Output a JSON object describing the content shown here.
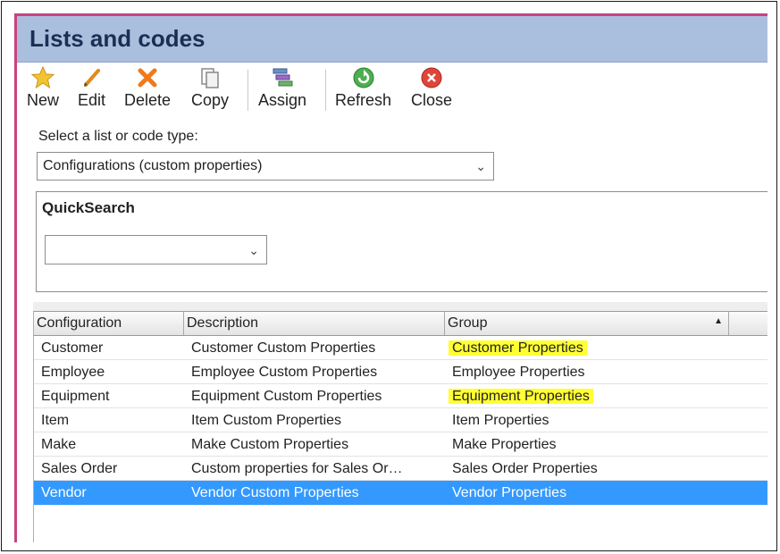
{
  "window": {
    "title": "Lists and codes"
  },
  "toolbar": {
    "new": "New",
    "edit": "Edit",
    "delete": "Delete",
    "copy": "Copy",
    "assign": "Assign",
    "refresh": "Refresh",
    "close": "Close"
  },
  "list_type": {
    "label": "Select a list or code type:",
    "value": "Configurations (custom properties)"
  },
  "quicksearch": {
    "title": "QuickSearch",
    "value": ""
  },
  "grid": {
    "columns": [
      "Configuration",
      "Description",
      "Group"
    ],
    "sort_column": "Group",
    "sort_direction": "ascending",
    "rows": [
      {
        "configuration": "Customer",
        "description": "Customer Custom Properties",
        "group": "Customer Properties",
        "highlight": true,
        "selected": false
      },
      {
        "configuration": "Employee",
        "description": "Employee Custom Properties",
        "group": "Employee Properties",
        "highlight": false,
        "selected": false
      },
      {
        "configuration": "Equipment",
        "description": "Equipment Custom Properties",
        "group": "Equipment Properties",
        "highlight": true,
        "selected": false
      },
      {
        "configuration": "Item",
        "description": "Item Custom Properties",
        "group": "Item Properties",
        "highlight": false,
        "selected": false
      },
      {
        "configuration": "Make",
        "description": "Make Custom Properties",
        "group": "Make Properties",
        "highlight": false,
        "selected": false
      },
      {
        "configuration": "Sales Order",
        "description": "Custom properties for Sales Or…",
        "group": "Sales Order Properties",
        "highlight": false,
        "selected": false
      },
      {
        "configuration": "Vendor",
        "description": "Vendor Custom Properties",
        "group": "Vendor Properties",
        "highlight": false,
        "selected": true
      }
    ]
  },
  "colors": {
    "titlebar": "#a9bfdd",
    "window_border": "#c8427f",
    "selection": "#3399ff",
    "highlight": "#ffff33"
  }
}
